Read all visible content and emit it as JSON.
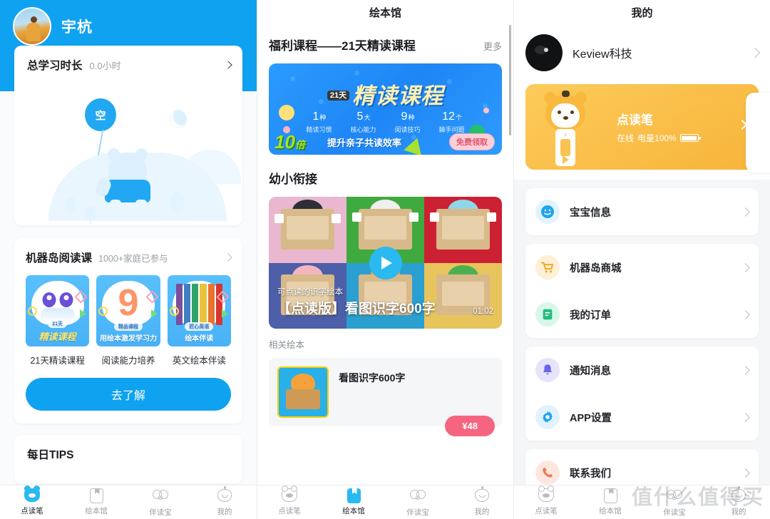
{
  "left_panel": {
    "user_name": "宇杭",
    "study": {
      "title": "总学习时长",
      "value": "0.0小时"
    },
    "illustration": {
      "balloon_text": "空"
    },
    "course": {
      "title": "机器岛阅读课",
      "subtitle": "1000+家庭已参与",
      "items": [
        {
          "label": "21天精读课程",
          "cover_tag": "21天",
          "cover_text": "精读课程"
        },
        {
          "label": "阅读能力培养",
          "cover_tag": "精品课程",
          "cover_text": "用绘本激发学习力"
        },
        {
          "label": "英文绘本伴读",
          "cover_tag": "匠心英语",
          "cover_text": "绘本伴读"
        }
      ],
      "button_label": "去了解"
    },
    "tips": {
      "title": "每日TIPS"
    },
    "tabs": [
      {
        "label": "点读笔",
        "icon": "pen-icon",
        "active": true
      },
      {
        "label": "绘本馆",
        "icon": "book-icon",
        "active": false
      },
      {
        "label": "伴读宝",
        "icon": "owl-icon",
        "active": false
      },
      {
        "label": "我的",
        "icon": "baby-icon",
        "active": false
      }
    ]
  },
  "middle_panel": {
    "header_title": "绘本馆",
    "welfare": {
      "section_title": "福利课程——21天精读课程",
      "more_label": "更多",
      "banner": {
        "badge": "21天",
        "headline": "精读课程",
        "stats": [
          {
            "num": "1",
            "unit": "种",
            "caption": "精读习惯"
          },
          {
            "num": "5",
            "unit": "大",
            "caption": "核心能力"
          },
          {
            "num": "9",
            "unit": "种",
            "caption": "阅读技巧"
          },
          {
            "num": "12",
            "unit": "个",
            "caption": "棘手问题"
          }
        ],
        "multiplier": "10",
        "multiplier_unit": "倍",
        "slogan": "提升亲子共读效率",
        "cta": "免费领取"
      }
    },
    "bridge": {
      "section_title": "幼小衔接",
      "video": {
        "subtitle": "可点读的识字绘本",
        "title": "【点读版】看图识字600字",
        "duration": "01:02"
      },
      "related_label": "相关绘本",
      "book": {
        "name": "看图识字600字",
        "price": "¥48"
      }
    },
    "tabs": [
      {
        "label": "点读笔",
        "icon": "pen-icon",
        "active": false
      },
      {
        "label": "绘本馆",
        "icon": "book-icon",
        "active": true
      },
      {
        "label": "伴读宝",
        "icon": "owl-icon",
        "active": false
      },
      {
        "label": "我的",
        "icon": "baby-icon",
        "active": false
      }
    ]
  },
  "right_panel": {
    "header_title": "我的",
    "account_name": "Keview科技",
    "device": {
      "title": "点读笔",
      "status": "在线",
      "battery": "电量100%"
    },
    "menu_groups": [
      [
        {
          "label": "宝宝信息",
          "icon": "smiley-icon",
          "color": "#1EA4F0"
        }
      ],
      [
        {
          "label": "机器岛商城",
          "icon": "cart-icon",
          "color": "#F5A623"
        },
        {
          "label": "我的订单",
          "icon": "order-icon",
          "color": "#22BE7C"
        }
      ],
      [
        {
          "label": "通知消息",
          "icon": "bell-icon",
          "color": "#6B63E8"
        },
        {
          "label": "APP设置",
          "icon": "gear-icon",
          "color": "#1EA4F0"
        }
      ],
      [
        {
          "label": "联系我们",
          "icon": "phone-icon",
          "color": "#F07A5A"
        }
      ]
    ],
    "tabs": [
      {
        "label": "点读笔",
        "icon": "pen-icon",
        "active": false
      },
      {
        "label": "绘本馆",
        "icon": "book-icon",
        "active": false
      },
      {
        "label": "伴读宝",
        "icon": "owl-icon",
        "active": false
      },
      {
        "label": "我的",
        "icon": "baby-icon",
        "active": false
      }
    ]
  },
  "watermark": {
    "text": "值什么值得买"
  },
  "theme": {
    "primary_blue": "#0FA2F0",
    "accent_yellow": "#F7B43A",
    "pink": "#F6657F"
  }
}
